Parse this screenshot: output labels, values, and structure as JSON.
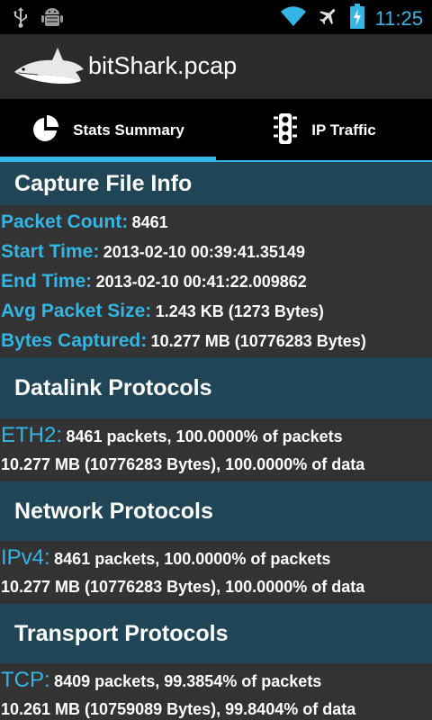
{
  "status_bar": {
    "time": "11:25",
    "icons": [
      "usb-icon",
      "android-debug-icon",
      "wifi-icon",
      "airplane-icon",
      "battery-charging-icon"
    ]
  },
  "app": {
    "title": "bitShark.pcap",
    "logo": "shark-logo-icon"
  },
  "tabs": [
    {
      "label": "Stats Summary",
      "icon": "pie-chart-icon",
      "active": true
    },
    {
      "label": "IP Traffic",
      "icon": "traffic-light-icon",
      "active": false
    }
  ],
  "capture_info": {
    "header": "Capture File Info",
    "rows": [
      {
        "label": "Packet Count:",
        "value": "8461"
      },
      {
        "label": "Start Time:",
        "value": "2013-02-10 00:39:41.35149"
      },
      {
        "label": "End Time:",
        "value": "2013-02-10 00:41:22.009862"
      },
      {
        "label": "Avg Packet Size:",
        "value": "1.243 KB (1273 Bytes)"
      },
      {
        "label": "Bytes Captured:",
        "value": "10.277 MB (10776283 Bytes)"
      }
    ]
  },
  "datalink": {
    "header": "Datalink Protocols",
    "protocol": "ETH2:",
    "packets": "8461 packets, 100.0000% of packets",
    "data": "10.277 MB (10776283 Bytes), 100.0000% of data"
  },
  "network": {
    "header": "Network Protocols",
    "protocol": "IPv4:",
    "packets": "8461 packets, 100.0000% of packets",
    "data": "10.277 MB (10776283 Bytes), 100.0000% of data"
  },
  "transport": {
    "header": "Transport Protocols",
    "protocol": "TCP:",
    "packets": "8409 packets, 99.3854% of packets",
    "data": "10.261 MB (10759089 Bytes), 99.8404% of data"
  },
  "colors": {
    "accent": "#33b5e5",
    "section_header": "#1f4556",
    "background": "#333333"
  }
}
